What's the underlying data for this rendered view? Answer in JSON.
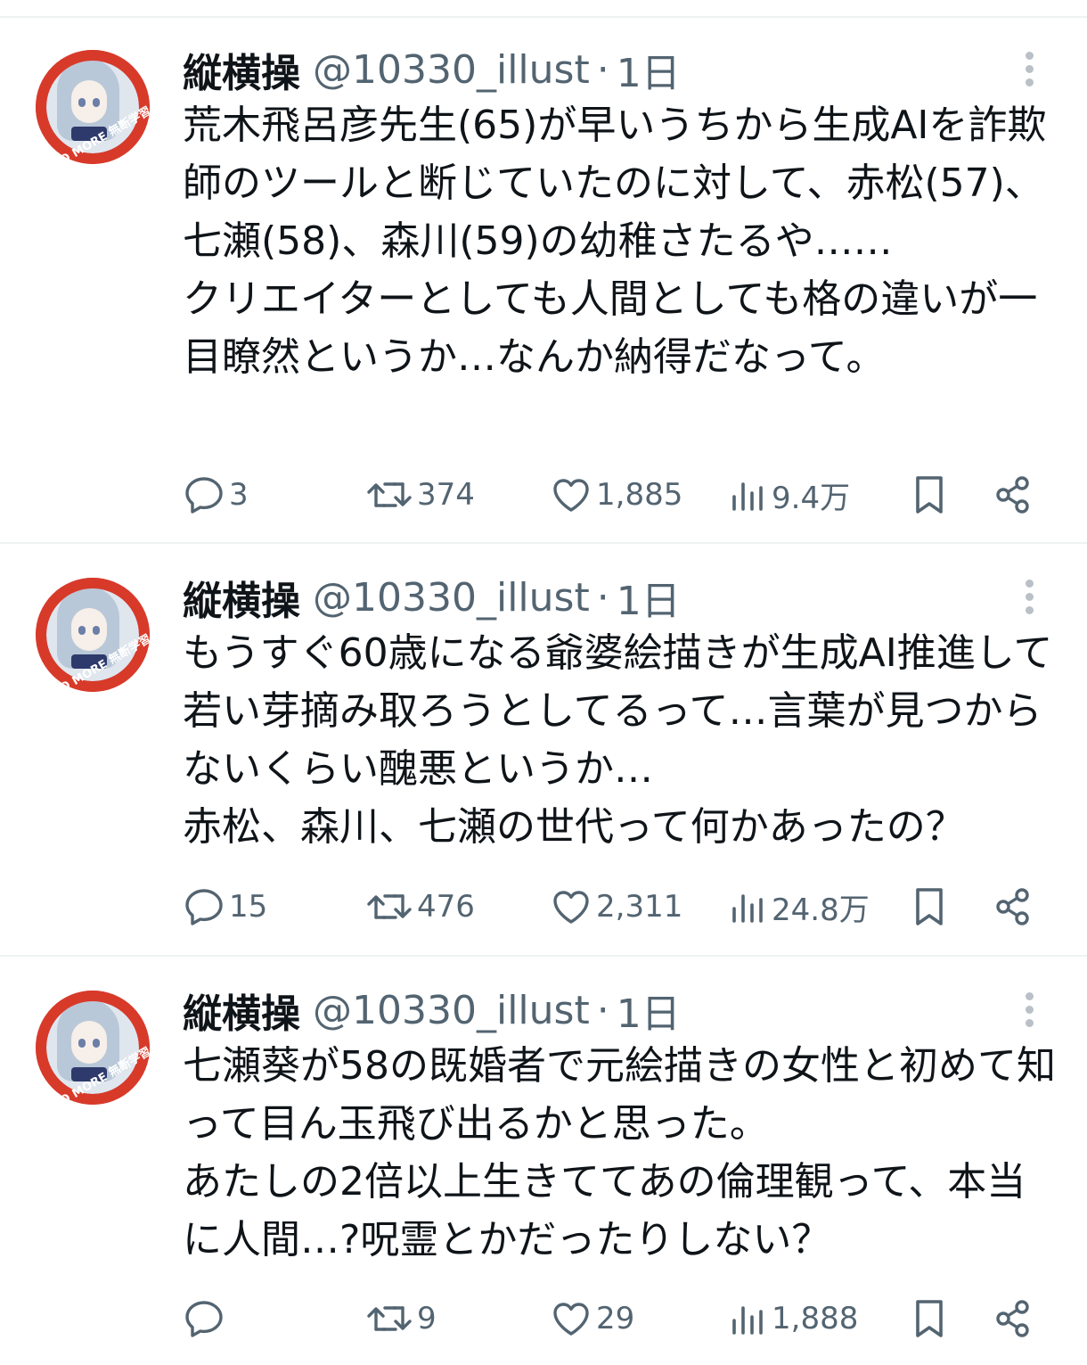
{
  "tweets": [
    {
      "author": {
        "name": "縦横操",
        "handle": "@10330_illust",
        "time": "1日"
      },
      "avatar": {
        "badge_text": "NO MORE 無断学習"
      },
      "text": "荒木飛呂彦先生(65)が早いうちから生成AIを詐欺師のツールと断じていたのに対して、赤松(57)、七瀬(58)、森川(59)の幼稚さたるや……\nクリエイターとしても人間としても格の違いが一目瞭然というか…なんか納得だなって。",
      "stats": {
        "replies": "3",
        "reposts": "374",
        "likes": "1,885",
        "views": "9.4万"
      }
    },
    {
      "author": {
        "name": "縦横操",
        "handle": "@10330_illust",
        "time": "1日"
      },
      "avatar": {
        "badge_text": "NO MORE 無断学習"
      },
      "text": "もうすぐ60歳になる爺婆絵描きが生成AI推進して若い芽摘み取ろうとしてるって…言葉が見つからないくらい醜悪というか…\n赤松、森川、七瀬の世代って何かあったの？",
      "stats": {
        "replies": "15",
        "reposts": "476",
        "likes": "2,311",
        "views": "24.8万"
      }
    },
    {
      "author": {
        "name": "縦横操",
        "handle": "@10330_illust",
        "time": "1日"
      },
      "avatar": {
        "badge_text": "NO MORE 無断学習"
      },
      "text": "七瀬葵が58の既婚者で元絵描きの女性と初めて知って目ん玉飛び出るかと思った。\nあたしの2倍以上生きててあの倫理観って、本当に人間…?呪霊とかだったりしない？",
      "stats": {
        "replies": "",
        "reposts": "9",
        "likes": "29",
        "views": "1,888"
      }
    }
  ],
  "ui": {
    "dot_separator": "·",
    "icons": {
      "reply": "speech-bubble-icon",
      "repost": "repost-arrows-icon",
      "like": "heart-icon",
      "views": "bar-chart-icon",
      "bookmark": "bookmark-icon",
      "share": "share-icon",
      "more": "vertical-dots-icon"
    },
    "colors": {
      "text": "#0f1419",
      "secondary": "#536471",
      "divider": "#eff3f4",
      "avatar_ring": "#d83a2a"
    }
  }
}
